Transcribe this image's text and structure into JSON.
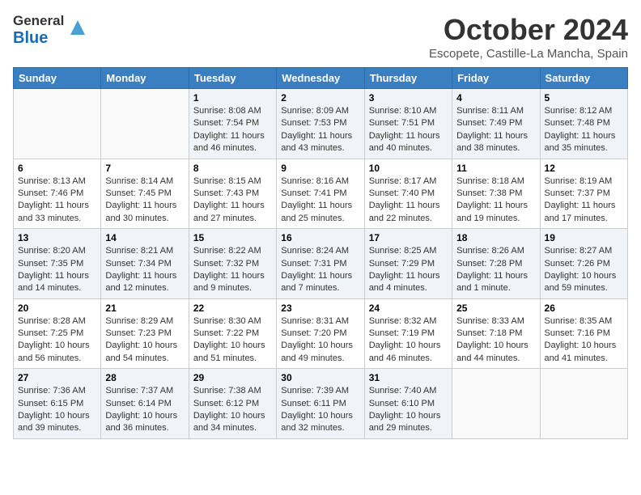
{
  "header": {
    "logo_line1": "General",
    "logo_line2": "Blue",
    "month": "October 2024",
    "location": "Escopete, Castille-La Mancha, Spain"
  },
  "weekdays": [
    "Sunday",
    "Monday",
    "Tuesday",
    "Wednesday",
    "Thursday",
    "Friday",
    "Saturday"
  ],
  "weeks": [
    [
      {
        "day": "",
        "info": ""
      },
      {
        "day": "",
        "info": ""
      },
      {
        "day": "1",
        "info": "Sunrise: 8:08 AM\nSunset: 7:54 PM\nDaylight: 11 hours and 46 minutes."
      },
      {
        "day": "2",
        "info": "Sunrise: 8:09 AM\nSunset: 7:53 PM\nDaylight: 11 hours and 43 minutes."
      },
      {
        "day": "3",
        "info": "Sunrise: 8:10 AM\nSunset: 7:51 PM\nDaylight: 11 hours and 40 minutes."
      },
      {
        "day": "4",
        "info": "Sunrise: 8:11 AM\nSunset: 7:49 PM\nDaylight: 11 hours and 38 minutes."
      },
      {
        "day": "5",
        "info": "Sunrise: 8:12 AM\nSunset: 7:48 PM\nDaylight: 11 hours and 35 minutes."
      }
    ],
    [
      {
        "day": "6",
        "info": "Sunrise: 8:13 AM\nSunset: 7:46 PM\nDaylight: 11 hours and 33 minutes."
      },
      {
        "day": "7",
        "info": "Sunrise: 8:14 AM\nSunset: 7:45 PM\nDaylight: 11 hours and 30 minutes."
      },
      {
        "day": "8",
        "info": "Sunrise: 8:15 AM\nSunset: 7:43 PM\nDaylight: 11 hours and 27 minutes."
      },
      {
        "day": "9",
        "info": "Sunrise: 8:16 AM\nSunset: 7:41 PM\nDaylight: 11 hours and 25 minutes."
      },
      {
        "day": "10",
        "info": "Sunrise: 8:17 AM\nSunset: 7:40 PM\nDaylight: 11 hours and 22 minutes."
      },
      {
        "day": "11",
        "info": "Sunrise: 8:18 AM\nSunset: 7:38 PM\nDaylight: 11 hours and 19 minutes."
      },
      {
        "day": "12",
        "info": "Sunrise: 8:19 AM\nSunset: 7:37 PM\nDaylight: 11 hours and 17 minutes."
      }
    ],
    [
      {
        "day": "13",
        "info": "Sunrise: 8:20 AM\nSunset: 7:35 PM\nDaylight: 11 hours and 14 minutes."
      },
      {
        "day": "14",
        "info": "Sunrise: 8:21 AM\nSunset: 7:34 PM\nDaylight: 11 hours and 12 minutes."
      },
      {
        "day": "15",
        "info": "Sunrise: 8:22 AM\nSunset: 7:32 PM\nDaylight: 11 hours and 9 minutes."
      },
      {
        "day": "16",
        "info": "Sunrise: 8:24 AM\nSunset: 7:31 PM\nDaylight: 11 hours and 7 minutes."
      },
      {
        "day": "17",
        "info": "Sunrise: 8:25 AM\nSunset: 7:29 PM\nDaylight: 11 hours and 4 minutes."
      },
      {
        "day": "18",
        "info": "Sunrise: 8:26 AM\nSunset: 7:28 PM\nDaylight: 11 hours and 1 minute."
      },
      {
        "day": "19",
        "info": "Sunrise: 8:27 AM\nSunset: 7:26 PM\nDaylight: 10 hours and 59 minutes."
      }
    ],
    [
      {
        "day": "20",
        "info": "Sunrise: 8:28 AM\nSunset: 7:25 PM\nDaylight: 10 hours and 56 minutes."
      },
      {
        "day": "21",
        "info": "Sunrise: 8:29 AM\nSunset: 7:23 PM\nDaylight: 10 hours and 54 minutes."
      },
      {
        "day": "22",
        "info": "Sunrise: 8:30 AM\nSunset: 7:22 PM\nDaylight: 10 hours and 51 minutes."
      },
      {
        "day": "23",
        "info": "Sunrise: 8:31 AM\nSunset: 7:20 PM\nDaylight: 10 hours and 49 minutes."
      },
      {
        "day": "24",
        "info": "Sunrise: 8:32 AM\nSunset: 7:19 PM\nDaylight: 10 hours and 46 minutes."
      },
      {
        "day": "25",
        "info": "Sunrise: 8:33 AM\nSunset: 7:18 PM\nDaylight: 10 hours and 44 minutes."
      },
      {
        "day": "26",
        "info": "Sunrise: 8:35 AM\nSunset: 7:16 PM\nDaylight: 10 hours and 41 minutes."
      }
    ],
    [
      {
        "day": "27",
        "info": "Sunrise: 7:36 AM\nSunset: 6:15 PM\nDaylight: 10 hours and 39 minutes."
      },
      {
        "day": "28",
        "info": "Sunrise: 7:37 AM\nSunset: 6:14 PM\nDaylight: 10 hours and 36 minutes."
      },
      {
        "day": "29",
        "info": "Sunrise: 7:38 AM\nSunset: 6:12 PM\nDaylight: 10 hours and 34 minutes."
      },
      {
        "day": "30",
        "info": "Sunrise: 7:39 AM\nSunset: 6:11 PM\nDaylight: 10 hours and 32 minutes."
      },
      {
        "day": "31",
        "info": "Sunrise: 7:40 AM\nSunset: 6:10 PM\nDaylight: 10 hours and 29 minutes."
      },
      {
        "day": "",
        "info": ""
      },
      {
        "day": "",
        "info": ""
      }
    ]
  ]
}
